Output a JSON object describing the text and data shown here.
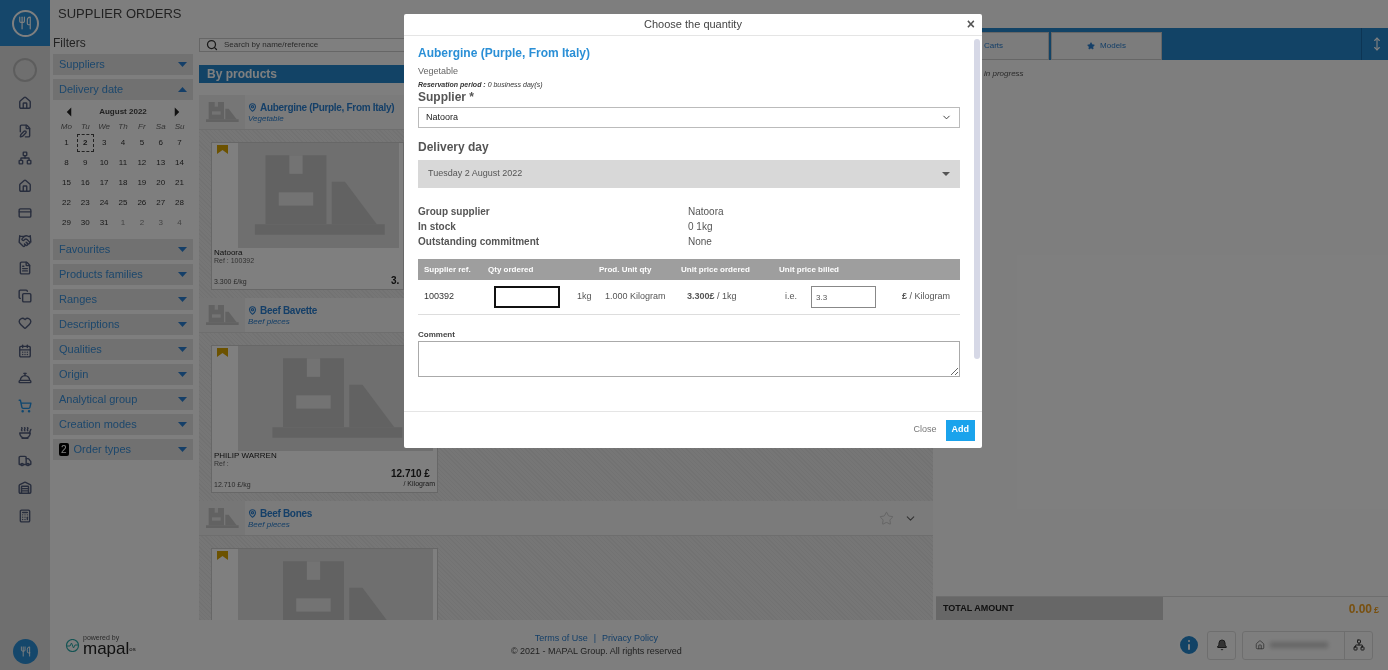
{
  "page_title": "SUPPLIER ORDERS",
  "nav": [
    {
      "selected": false
    },
    {
      "selected": false
    },
    {
      "selected": false
    },
    {
      "selected": false
    },
    {
      "selected": false
    },
    {
      "selected": false
    },
    {
      "selected": false
    },
    {
      "selected": false
    },
    {
      "selected": false
    },
    {
      "selected": false
    },
    {
      "selected": false
    },
    {
      "selected": true
    },
    {
      "selected": false
    },
    {
      "selected": false
    },
    {
      "selected": false
    },
    {
      "selected": false
    }
  ],
  "filters": {
    "title": "Filters",
    "sections_top": [
      {
        "label": "Suppliers",
        "expanded": false
      },
      {
        "label": "Delivery date",
        "expanded": true
      }
    ],
    "calendar": {
      "month": "August 2022",
      "weekdays": [
        "Mo",
        "Tu",
        "We",
        "Th",
        "Fr",
        "Sa",
        "Su"
      ],
      "days": [
        {
          "label": "1",
          "muted": false,
          "selected": false
        },
        {
          "label": "2",
          "muted": false,
          "selected": true
        },
        {
          "label": "3",
          "muted": false,
          "selected": false
        },
        {
          "label": "4",
          "muted": false,
          "selected": false
        },
        {
          "label": "5",
          "muted": false,
          "selected": false
        },
        {
          "label": "6",
          "muted": false,
          "selected": false
        },
        {
          "label": "7",
          "muted": false,
          "selected": false
        },
        {
          "label": "8",
          "muted": false,
          "selected": false
        },
        {
          "label": "9",
          "muted": false,
          "selected": false
        },
        {
          "label": "10",
          "muted": false,
          "selected": false
        },
        {
          "label": "11",
          "muted": false,
          "selected": false
        },
        {
          "label": "12",
          "muted": false,
          "selected": false
        },
        {
          "label": "13",
          "muted": false,
          "selected": false
        },
        {
          "label": "14",
          "muted": false,
          "selected": false
        },
        {
          "label": "15",
          "muted": false,
          "selected": false
        },
        {
          "label": "16",
          "muted": false,
          "selected": false
        },
        {
          "label": "17",
          "muted": false,
          "selected": false
        },
        {
          "label": "18",
          "muted": false,
          "selected": false
        },
        {
          "label": "19",
          "muted": false,
          "selected": false
        },
        {
          "label": "20",
          "muted": false,
          "selected": false
        },
        {
          "label": "21",
          "muted": false,
          "selected": false
        },
        {
          "label": "22",
          "muted": false,
          "selected": false
        },
        {
          "label": "23",
          "muted": false,
          "selected": false
        },
        {
          "label": "24",
          "muted": false,
          "selected": false
        },
        {
          "label": "25",
          "muted": false,
          "selected": false
        },
        {
          "label": "26",
          "muted": false,
          "selected": false
        },
        {
          "label": "27",
          "muted": false,
          "selected": false
        },
        {
          "label": "28",
          "muted": false,
          "selected": false
        },
        {
          "label": "29",
          "muted": false,
          "selected": false
        },
        {
          "label": "30",
          "muted": false,
          "selected": false
        },
        {
          "label": "31",
          "muted": false,
          "selected": false
        },
        {
          "label": "1",
          "muted": true,
          "selected": false
        },
        {
          "label": "2",
          "muted": true,
          "selected": false
        },
        {
          "label": "3",
          "muted": true,
          "selected": false
        },
        {
          "label": "4",
          "muted": true,
          "selected": false
        }
      ]
    },
    "sections": [
      {
        "label": "Favourites",
        "expanded": false
      },
      {
        "label": "Products families",
        "expanded": false
      },
      {
        "label": "Ranges",
        "expanded": false
      },
      {
        "label": "Descriptions",
        "expanded": false
      },
      {
        "label": "Qualities",
        "expanded": false
      },
      {
        "label": "Origin",
        "expanded": false
      },
      {
        "label": "Analytical group",
        "expanded": false
      },
      {
        "label": "Creation modes",
        "expanded": false
      },
      {
        "label": "Order types",
        "expanded": false,
        "count": "2"
      }
    ]
  },
  "search": {
    "placeholder": "Search by name/reference"
  },
  "products_title": "By products",
  "products": [
    {
      "name": "Aubergine (Purple, From Italy)",
      "family": "Vegetable",
      "offer": {
        "supplier": "Natoora",
        "ref": "Ref : 100392",
        "unit_price": "3.300 £/kg",
        "price": "3."
      }
    },
    {
      "name": "Beef Bavette",
      "family": "Beef pieces",
      "offer": {
        "supplier": "PHILIP WARREN",
        "ref": "Ref :",
        "unit_price": "12.710 £/kg",
        "price": "12.710 £",
        "unit": "/ Kilogram"
      }
    },
    {
      "name": "Beef Bones",
      "family": "Beef pieces"
    }
  ],
  "cart_tabs": [
    "Carts",
    "Models"
  ],
  "cart_status": "in progress",
  "total": {
    "label": "TOTAL AMOUNT",
    "value": "0.00",
    "currency": "£"
  },
  "footer": {
    "powered_by": "powered by",
    "brand": "mapal",
    "brand_sup": "os",
    "links": [
      "Terms of Use",
      "Privacy Policy"
    ],
    "separator": "|",
    "copyright": "© 2021 - MAPAL Group. All rights reserved"
  },
  "modal": {
    "title": "Choose the quantity",
    "close": "×",
    "product": "Aubergine (Purple, From Italy)",
    "family": "Vegetable",
    "reservation": "**Reservation period :** 0 business day(s)",
    "supplier_label": "Supplier *",
    "supplier_value": "Natoora",
    "delivery_label": "Delivery day",
    "delivery_value": "Tuesday 2 August 2022",
    "info": [
      {
        "label": "Group supplier",
        "value": "Natoora"
      },
      {
        "label": "In stock",
        "value": "0 1kg"
      },
      {
        "label": "Outstanding commitment",
        "value": "None"
      }
    ],
    "columns": [
      "Supplier ref.",
      "Qty ordered",
      "Prod. Unit qty",
      "Unit price ordered",
      "Unit price billed"
    ],
    "row": {
      "ref": "100392",
      "qty_unit": "1kg",
      "prod_unit_qty": "1.000 Kilogram",
      "unit_price": "**3.300£** / 1kg",
      "ie": "i.e.",
      "billed": "3.3",
      "billed_unit": "**£** / Kilogram"
    },
    "comment_label": "Comment",
    "buttons": {
      "close": "Close",
      "add": "Add"
    }
  }
}
